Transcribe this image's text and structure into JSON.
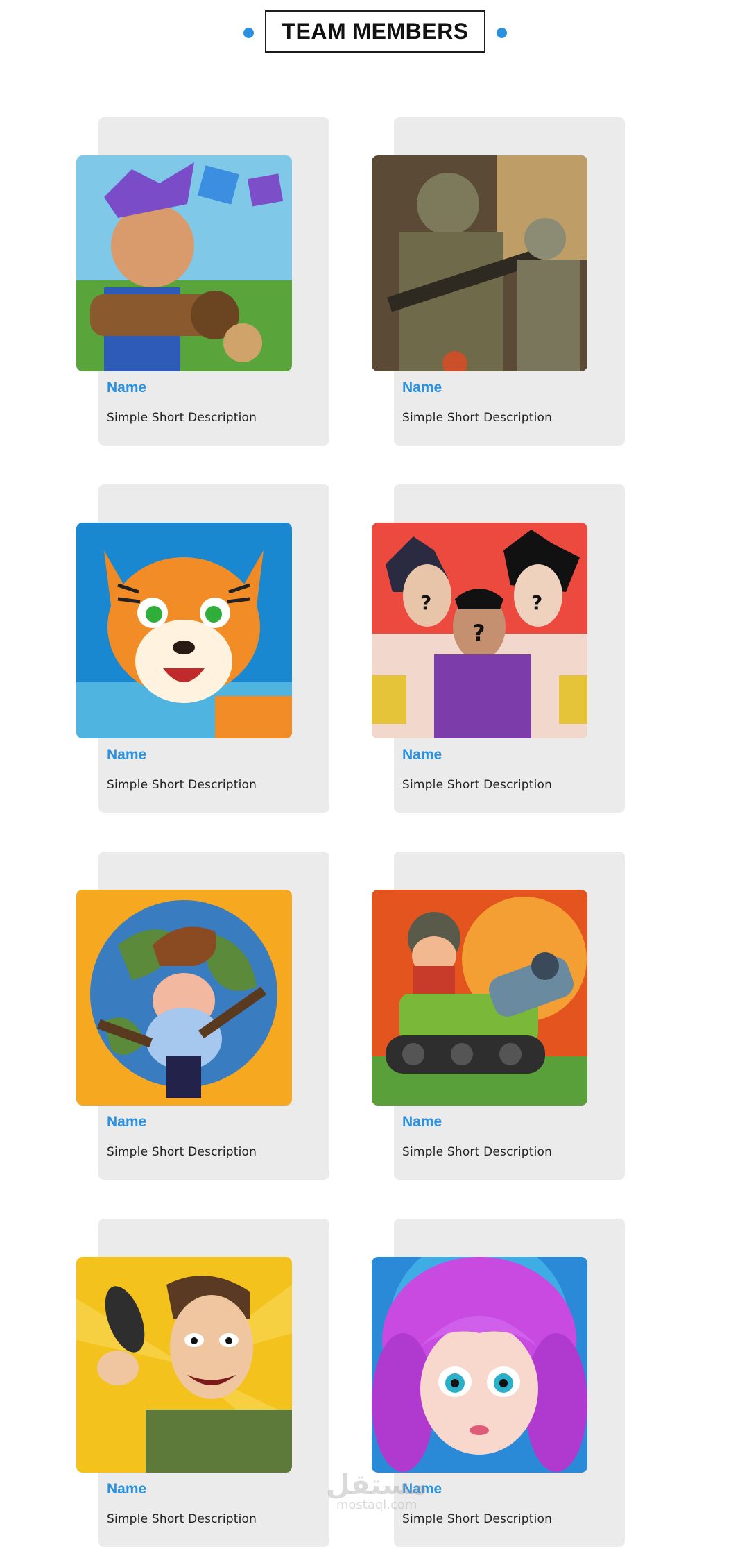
{
  "header": {
    "title": "TEAM MEMBERS"
  },
  "team": {
    "members": [
      {
        "name": "Name",
        "description": "Simple Short Description",
        "image": "purple-hair-hero-bazooka"
      },
      {
        "name": "Name",
        "description": "Simple Short Description",
        "image": "soldiers-with-rifles"
      },
      {
        "name": "Name",
        "description": "Simple Short Description",
        "image": "cartoon-tiger"
      },
      {
        "name": "Name",
        "description": "Simple Short Description",
        "image": "anime-characters-question-marks"
      },
      {
        "name": "Name",
        "description": "Simple Short Description",
        "image": "miner-dwarf-globe"
      },
      {
        "name": "Name",
        "description": "Simple Short Description",
        "image": "soldier-on-green-tank"
      },
      {
        "name": "Name",
        "description": "Simple Short Description",
        "image": "man-with-telephone"
      },
      {
        "name": "Name",
        "description": "Simple Short Description",
        "image": "pink-hair-doll-girl"
      }
    ]
  },
  "watermark": {
    "arabic": "مستقل",
    "latin": "mostaql.com"
  },
  "colors": {
    "accent": "#2a90e0",
    "card_background": "#ebebeb",
    "title_border": "#1c1c1c"
  }
}
